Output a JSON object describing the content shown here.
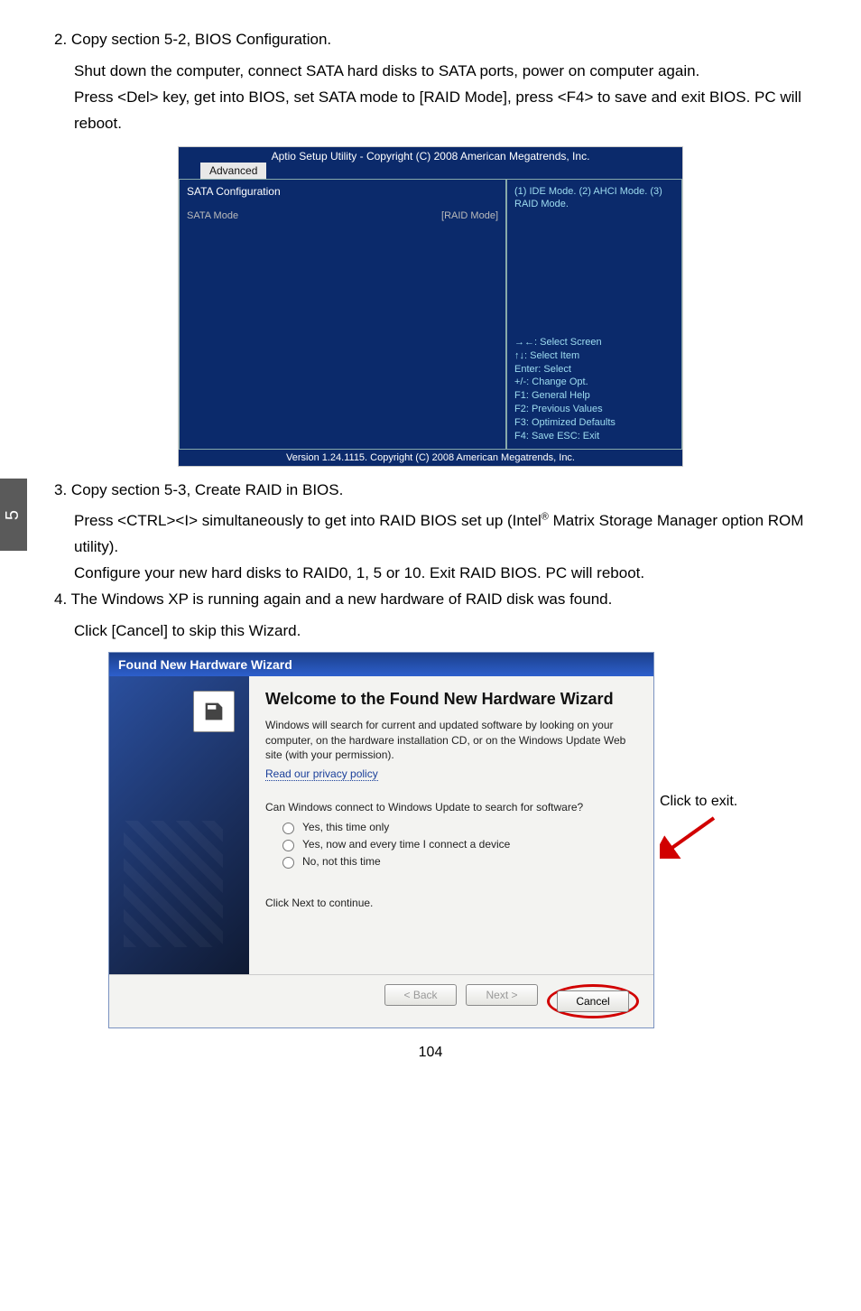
{
  "side_tab": "5",
  "steps": {
    "s2": {
      "num": "2.",
      "title": "Copy section 5-2, BIOS Configuration.",
      "line1": "Shut down the computer, connect SATA hard disks to SATA ports, power on computer again.",
      "line2": "Press <Del> key, get into BIOS, set SATA mode to [RAID Mode], press <F4> to save and exit BIOS. PC will reboot."
    },
    "s3": {
      "num": "3.",
      "title": "Copy section 5-3, Create RAID in BIOS.",
      "line1a": "Press <CTRL><I> simultaneously to get into RAID BIOS set up (Intel",
      "line1b": " Matrix Storage Manager option ROM utility).",
      "reg": "®",
      "line2": "Configure your new hard disks to RAID0, 1, 5 or 10. Exit RAID BIOS. PC will reboot."
    },
    "s4": {
      "num": "4.",
      "title": "The Windows XP is running again and a new hardware of RAID disk was found.",
      "line1": "Click [Cancel] to skip this Wizard."
    }
  },
  "bios": {
    "header": "Aptio Setup Utility - Copyright (C) 2008 American Megatrends, Inc.",
    "tab": "Advanced",
    "section": "SATA Configuration",
    "row_label": "SATA Mode",
    "row_value": "[RAID Mode]",
    "help": "(1) IDE Mode. (2) AHCI Mode. (3) RAID Mode.",
    "keys": {
      "k1": "→←: Select Screen",
      "k2": "↑↓: Select Item",
      "k3": "Enter: Select",
      "k4": "+/-: Change Opt.",
      "k5": "F1:  General Help",
      "k6": "F2:  Previous Values",
      "k7": "F3: Optimized Defaults",
      "k8": "F4: Save  ESC: Exit"
    },
    "footer": "Version 1.24.1115. Copyright (C) 2008 American Megatrends, Inc."
  },
  "wizard": {
    "title": "Found New Hardware Wizard",
    "heading": "Welcome to the Found New Hardware Wizard",
    "para1": "Windows will search for current and updated software by looking on your computer, on the hardware installation CD, or on the Windows Update Web site (with your permission).",
    "privacy": "Read our privacy policy",
    "para2": "Can Windows connect to Windows Update to search for software?",
    "opt1": "Yes, this time only",
    "opt2": "Yes, now and every time I connect a device",
    "opt3": "No, not this time",
    "continue": "Click Next to continue.",
    "btn_back": "< Back",
    "btn_next": "Next >",
    "btn_cancel": "Cancel"
  },
  "annotation": "Click to exit.",
  "page_number": "104"
}
